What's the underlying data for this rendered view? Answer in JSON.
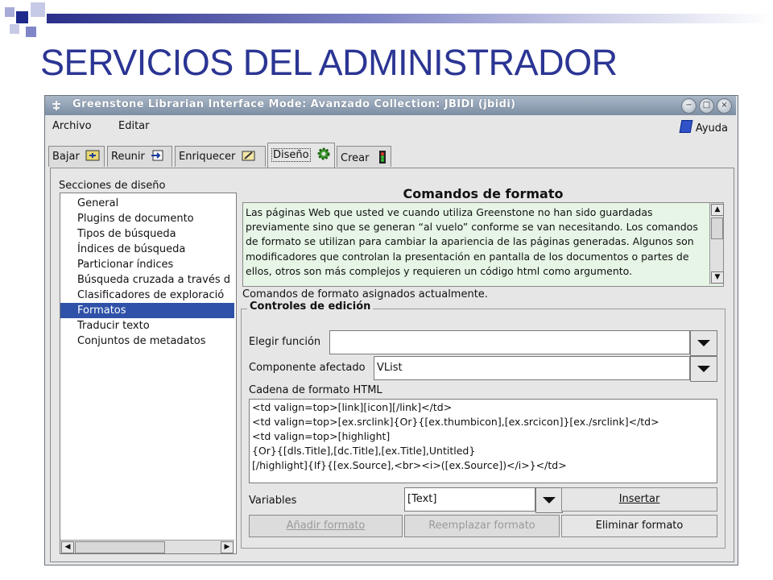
{
  "slide": {
    "title": "SERVICIOS DEL ADMINISTRADOR"
  },
  "window": {
    "title": "Greenstone Librarian Interface  Mode: Avanzado  Collection: JBIDI (jbidi)",
    "buttons": [
      "minimize",
      "maximize",
      "close"
    ]
  },
  "menu": {
    "file": "Archivo",
    "edit": "Editar",
    "help": "Ayuda"
  },
  "tabs": [
    {
      "label": "Bajar",
      "icon": "download-icon"
    },
    {
      "label": "Reunir",
      "icon": "gather-icon"
    },
    {
      "label": "Enriquecer",
      "icon": "enrich-icon"
    },
    {
      "label": "Diseño",
      "icon": "gear-icon",
      "active": true
    },
    {
      "label": "Crear",
      "icon": "traffic-light-icon"
    }
  ],
  "sections": {
    "label": "Secciones de diseño",
    "items": [
      "General",
      "Plugins de documento",
      "Tipos de búsqueda",
      "Índices de búsqueda",
      "Particionar índices",
      "Búsqueda cruzada a través d",
      "Clasificadores de exploració",
      "Formatos",
      "Traducir texto",
      "Conjuntos de metadatos"
    ],
    "selected": "Formatos"
  },
  "main": {
    "title": "Comandos de formato",
    "description": "Las páginas Web que usted ve cuando utiliza Greenstone no han sido guardadas previamente sino que se generan “al vuelo” conforme se van necesitando. Los comandos de formato se utilizan para cambiar la apariencia de las páginas generadas. Algunos son modificadores que controlan la presentación en pantalla de los documentos o partes de ellos, otros son más complejos y requieren un código html como argumento.",
    "assigned_label": "Comandos de formato asignados actualmente.",
    "controls_legend": "Controles de edición",
    "choose_function_label": "Elegir función",
    "choose_function_value": "",
    "component_label": "Componente afectado",
    "component_value": "VList",
    "html_label": "Cadena de formato HTML",
    "html_value": "<td valign=top>[link][icon][/link]</td>\n<td valign=top>[ex.srclink]{Or}{[ex.thumbicon],[ex.srcicon]}[ex./srclink]</td>\n<td valign=top>[highlight]\n{Or}{[dls.Title],[dc.Title],[ex.Title],Untitled}\n[/highlight]{If}{[ex.Source],<br><i>([ex.Source])</i>}</td>",
    "variables_label": "Variables",
    "variables_value": "[Text]",
    "insert_button": "Insertar",
    "add_button": "Añadir formato",
    "replace_button": "Reemplazar formato",
    "remove_button": "Eliminar formato"
  },
  "colors": {
    "title_blue": "#2b3593",
    "selection": "#2f52a8",
    "description_bg": "#e6f5e6"
  }
}
